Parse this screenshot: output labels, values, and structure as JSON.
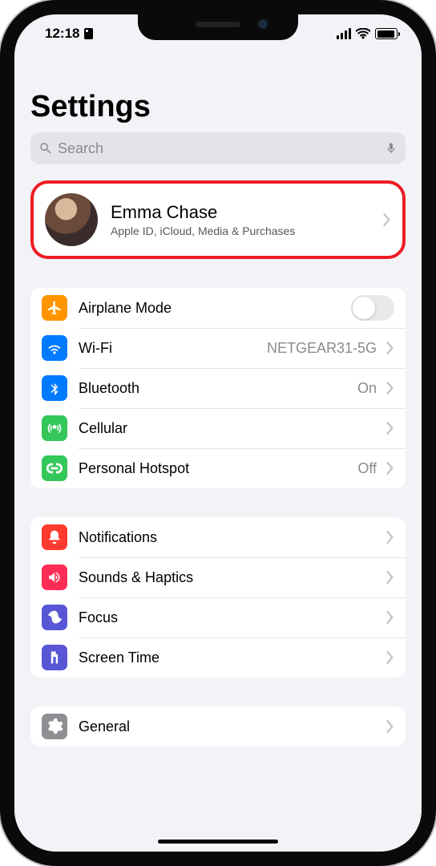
{
  "status": {
    "time": "12:18"
  },
  "page": {
    "title": "Settings"
  },
  "search": {
    "placeholder": "Search"
  },
  "profile": {
    "name": "Emma Chase",
    "subtitle": "Apple ID, iCloud, Media & Purchases"
  },
  "groups": [
    {
      "rows": [
        {
          "label": "Airplane Mode",
          "value": "",
          "control": "toggle"
        },
        {
          "label": "Wi-Fi",
          "value": "NETGEAR31-5G",
          "control": "chevron"
        },
        {
          "label": "Bluetooth",
          "value": "On",
          "control": "chevron"
        },
        {
          "label": "Cellular",
          "value": "",
          "control": "chevron"
        },
        {
          "label": "Personal Hotspot",
          "value": "Off",
          "control": "chevron"
        }
      ]
    },
    {
      "rows": [
        {
          "label": "Notifications",
          "value": "",
          "control": "chevron"
        },
        {
          "label": "Sounds & Haptics",
          "value": "",
          "control": "chevron"
        },
        {
          "label": "Focus",
          "value": "",
          "control": "chevron"
        },
        {
          "label": "Screen Time",
          "value": "",
          "control": "chevron"
        }
      ]
    },
    {
      "rows": [
        {
          "label": "General",
          "value": "",
          "control": "chevron"
        }
      ]
    }
  ]
}
